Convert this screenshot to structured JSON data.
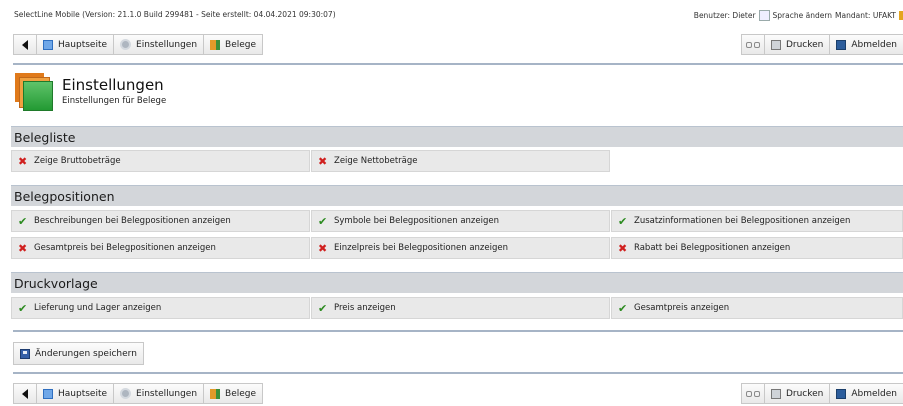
{
  "status": {
    "app_info": "SelectLine Mobile (Version: 21.1.0 Build 299481 - Seite erstellt: 04.04.2021 09:30:07)",
    "user": "Benutzer: Dieter",
    "language_alt": "Sprache ändern",
    "client": "Mandant: UFAKT"
  },
  "toolbar": {
    "home_label": "Hauptseite",
    "settings_label": "Einstellungen",
    "belege_label": "Belege",
    "print_label": "Drucken",
    "logout_label": "Abmelden"
  },
  "page": {
    "title": "Einstellungen",
    "subtitle": "Einstellungen für Belege"
  },
  "sections": [
    {
      "title": "Belegliste",
      "rows": [
        [
          {
            "label": "Zeige Bruttobeträge",
            "state": "off"
          },
          {
            "label": "Zeige Nettobeträge",
            "state": "off"
          }
        ]
      ]
    },
    {
      "title": "Belegpositionen",
      "rows": [
        [
          {
            "label": "Beschreibungen bei Belegpositionen anzeigen",
            "state": "on"
          },
          {
            "label": "Symbole bei Belegpositionen anzeigen",
            "state": "on"
          },
          {
            "label": "Zusatzinformationen bei Belegpositionen anzeigen",
            "state": "on"
          }
        ],
        [
          {
            "label": "Gesamtpreis bei Belegpositionen anzeigen",
            "state": "off"
          },
          {
            "label": "Einzelpreis bei Belegpositionen anzeigen",
            "state": "off"
          },
          {
            "label": "Rabatt bei Belegpositionen anzeigen",
            "state": "off"
          }
        ]
      ]
    },
    {
      "title": "Druckvorlage",
      "rows": [
        [
          {
            "label": "Lieferung und Lager anzeigen",
            "state": "on"
          },
          {
            "label": "Preis anzeigen",
            "state": "on"
          },
          {
            "label": "Gesamtpreis anzeigen",
            "state": "on"
          }
        ]
      ]
    }
  ],
  "save_label": "Änderungen speichern",
  "icons": {
    "on": "check-icon",
    "off": "cross-icon"
  },
  "colors": {
    "check": "#2b8a1f",
    "cross": "#d0201f",
    "section_bg": "#d3d6da"
  }
}
